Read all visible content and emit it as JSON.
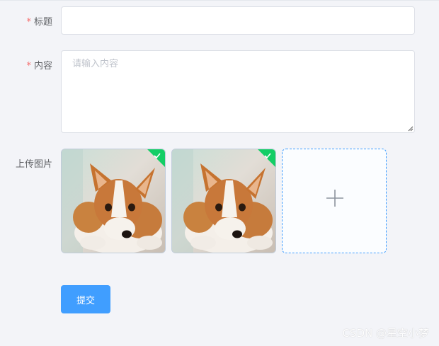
{
  "form": {
    "title_field": {
      "required_mark": "*",
      "label": "标题",
      "value": ""
    },
    "content_field": {
      "required_mark": "*",
      "label": "内容",
      "placeholder": "请输入内容"
    },
    "upload_field": {
      "label": "上传图片",
      "images": [
        {
          "icon": "success-check-icon",
          "status": "success"
        },
        {
          "icon": "success-check-icon",
          "status": "success"
        }
      ],
      "add_icon": "plus-icon"
    },
    "submit_label": "提交"
  },
  "watermark": "CSDN @星空小梦",
  "colors": {
    "primary": "#409eff",
    "required": "#f56c6c",
    "success": "#13ce66",
    "background": "#f3f4f8"
  }
}
